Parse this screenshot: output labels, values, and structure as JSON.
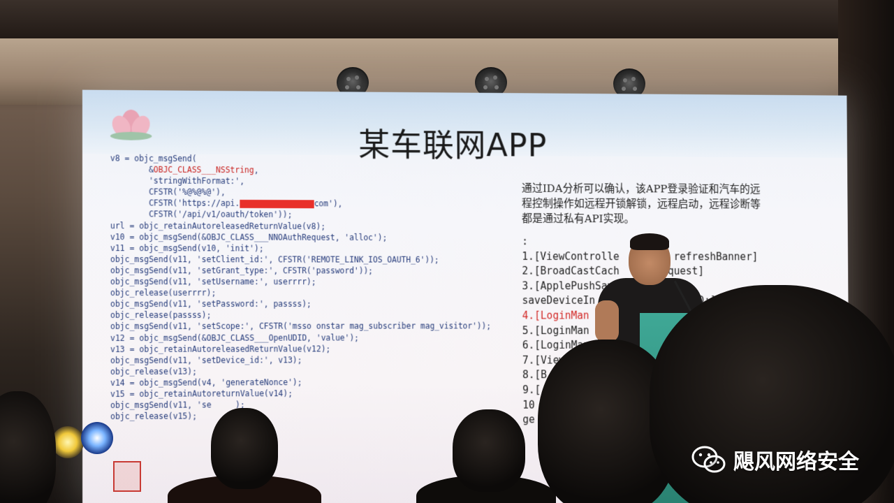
{
  "slide": {
    "title": "某车联网APP",
    "code_lines": [
      {
        "text": "v8 = objc_msgSend(",
        "red": false
      },
      {
        "text": "        &OBJC_CLASS___NSString,",
        "red": false,
        "red_part": "OBJC_CLASS___NSString"
      },
      {
        "text": "        'stringWithFormat:',",
        "red": false
      },
      {
        "text": "        CFSTR('%@%@%@'),",
        "red": false
      },
      {
        "text": "        CFSTR('https://api.",
        "red": false,
        "redacted": true,
        "after": "com'),"
      },
      {
        "text": "        CFSTR('/api/v1/oauth/token'));",
        "red": false
      },
      {
        "text": "url = objc_retainAutoreleasedReturnValue(v8);",
        "red": false
      },
      {
        "text": "v10 = objc_msgSend(&OBJC_CLASS___NNOAuthRequest, 'alloc');",
        "red": false
      },
      {
        "text": "v11 = objc_msgSend(v10, 'init');",
        "red": false
      },
      {
        "text": "objc_msgSend(v11, 'setClient_id:', CFSTR('REMOTE_LINK_IOS_OAUTH_6'));",
        "red": false
      },
      {
        "text": "objc_msgSend(v11, 'setGrant_type:', CFSTR('password'));",
        "red": false
      },
      {
        "text": "objc_msgSend(v11, 'setUsername:', userrrr);",
        "red": false
      },
      {
        "text": "objc_release(userrrr);",
        "red": false
      },
      {
        "text": "objc_msgSend(v11, 'setPassword:', passss);",
        "red": false
      },
      {
        "text": "objc_release(passss);",
        "red": false
      },
      {
        "text": "objc_msgSend(v11, 'setScope:', CFSTR('msso onstar mag_subscriber mag_visitor'));",
        "red": false
      },
      {
        "text": "v12 = objc_msgSend(&OBJC_CLASS___OpenUDID, 'value');",
        "red": false
      },
      {
        "text": "v13 = objc_retainAutoreleasedReturnValue(v12);",
        "red": false
      },
      {
        "text": "objc_msgSend(v11, 'setDevice_id:', v13);",
        "red": false
      },
      {
        "text": "objc_release(v13);",
        "red": false
      },
      {
        "text": "v14 = objc_msgSend(v4, 'generateNonce');",
        "red": false
      },
      {
        "text": "v15 = objc_retainAutore",
        "red": false,
        "after": "turnValue(v14);"
      },
      {
        "text": "objc_msgSend(v11, 'se",
        "red": false,
        "after": "     );"
      },
      {
        "text": "objc_release(v15);",
        "red": false
      }
    ],
    "explanation": "通过IDA分析可以确认，该APP登录验证和汽车的远程控制操作如远程开锁解锁，远程启动，远程诊断等都是通过私有API实现。",
    "list_intro": ":",
    "list_items": [
      {
        "text": "1.[ViewControlle    page refreshBanner]",
        "red": false
      },
      {
        "text": "2.[BroadCastCach     dRequest]",
        "red": false
      },
      {
        "text": "3.[ApplePushSave",
        "red": false
      },
      {
        "text": "saveDeviceIn          d:userID:]",
        "red": false
      },
      {
        "text": "4.[LoginMan          WithUserNam",
        "red": true
      },
      {
        "text": "5.[LoginMan",
        "red": false
      },
      {
        "text": "6.[LoginMan",
        "red": false
      },
      {
        "text": "7.[ViewC",
        "red": false
      },
      {
        "text": "8.[B",
        "red": false
      },
      {
        "text": "9.[",
        "red": false
      },
      {
        "text": "10",
        "red": false
      },
      {
        "text": "ge",
        "red": false
      }
    ]
  },
  "watermark": {
    "text": "飓风网络安全",
    "icon": "wechat-icon"
  },
  "colors": {
    "code_blue": "#243a7a",
    "code_red": "#c8201e",
    "redaction": "#e8302a",
    "podium": "#3fa896"
  }
}
